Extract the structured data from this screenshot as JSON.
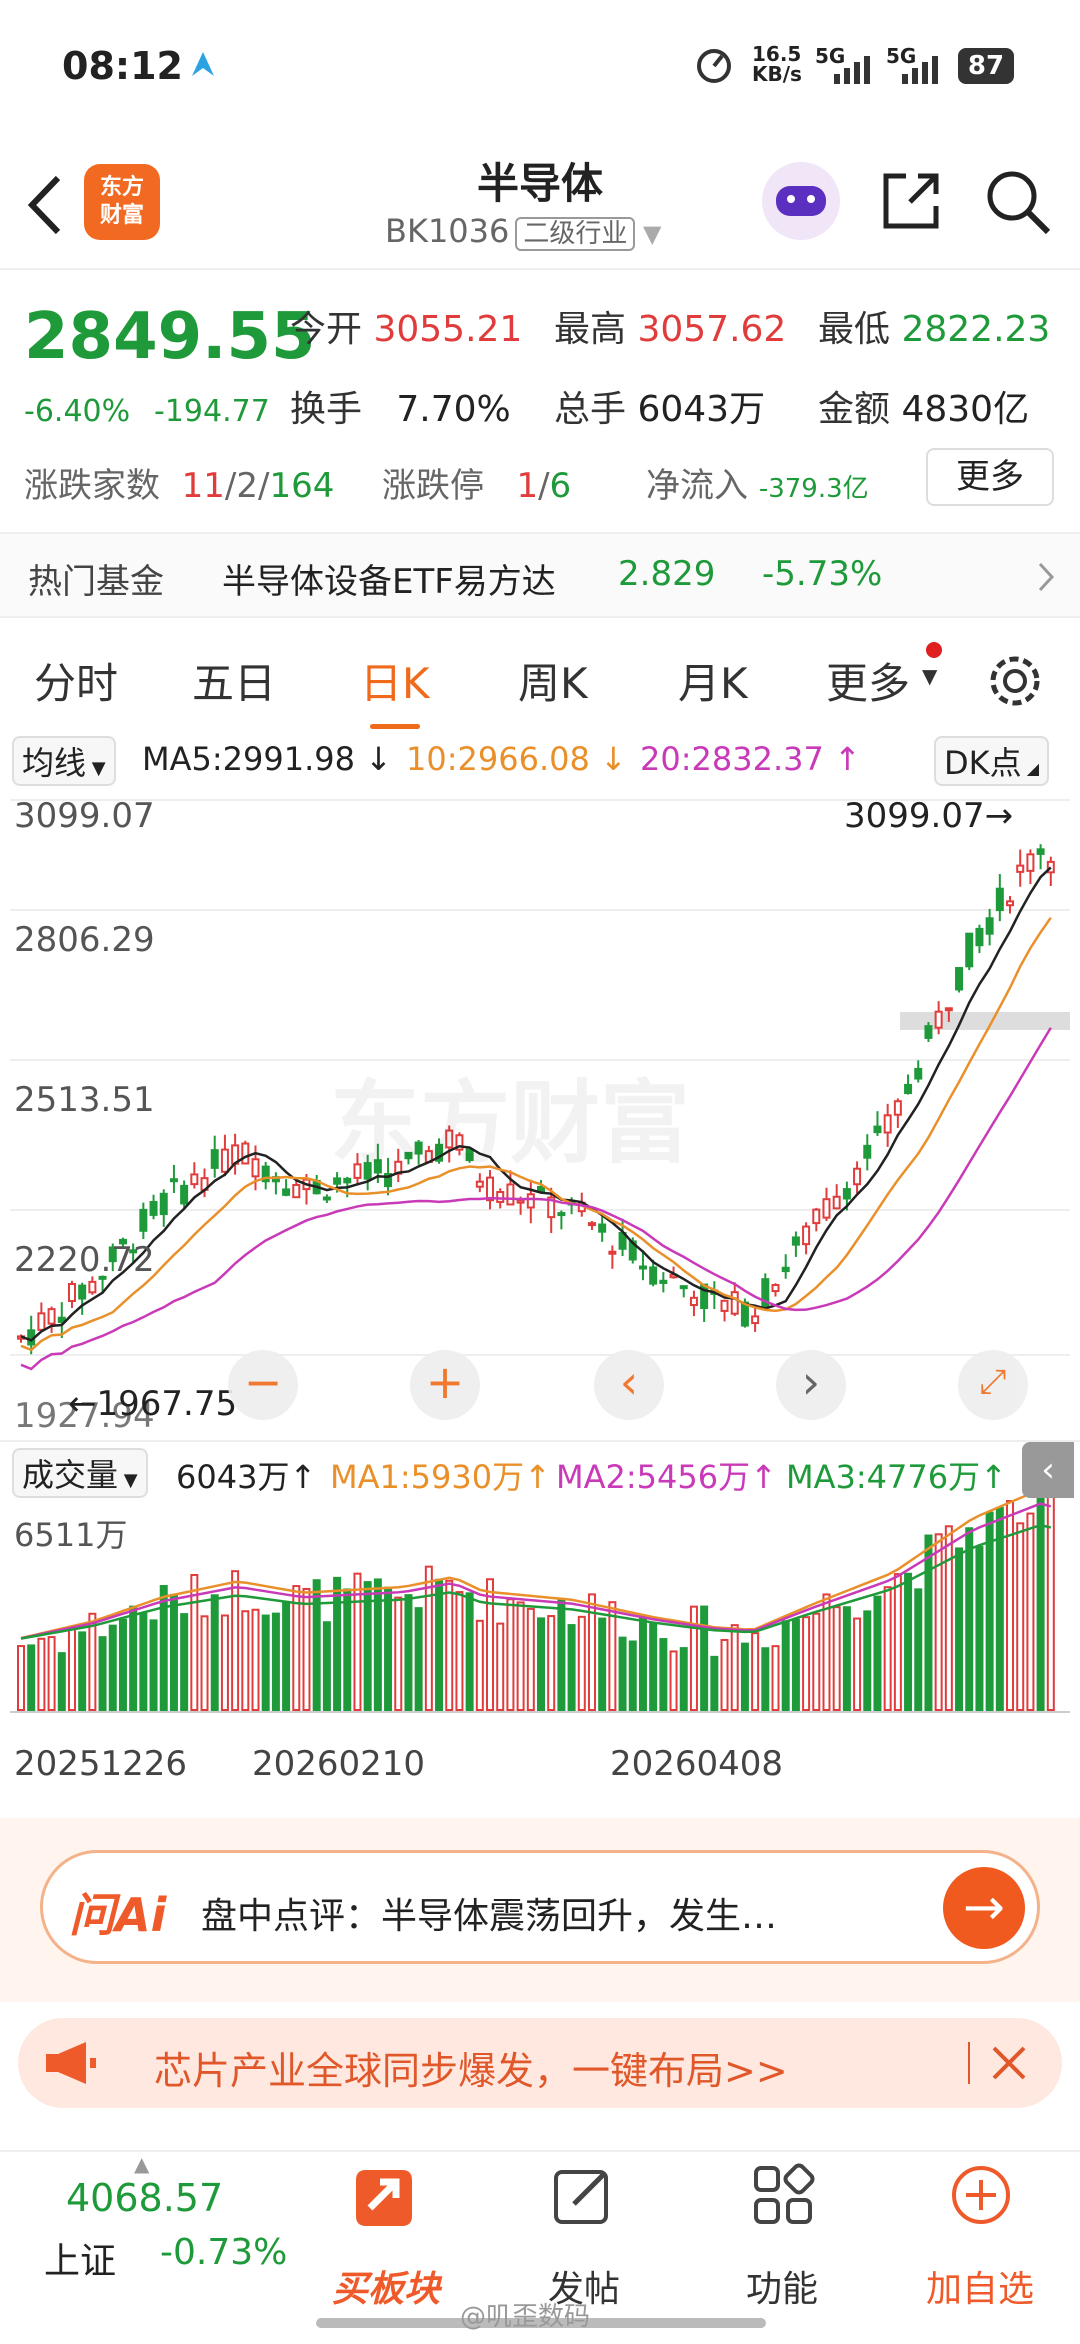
{
  "status": {
    "time": "08:12",
    "speed": "16.5",
    "speed_unit": "KB/s",
    "net1": "5G",
    "net2": "5G",
    "battery": "87"
  },
  "header": {
    "title": "半导体",
    "code": "BK1036",
    "tag": "二级行业",
    "logo_line1": "东方",
    "logo_line2": "财富"
  },
  "quote": {
    "price": "2849.55",
    "change_pct": "-6.40%",
    "change": "-194.77",
    "open_label": "今开",
    "open": "3055.21",
    "high_label": "最高",
    "high": "3057.62",
    "low_label": "最低",
    "low": "2822.23",
    "turnover_label": "换手",
    "turnover": "7.70%",
    "volume_label": "总手",
    "volume": "6043万",
    "amount_label": "金额",
    "amount": "4830亿",
    "updown_label": "涨跌家数",
    "up": "11",
    "flat": "2",
    "down": "164",
    "limit_label": "涨跌停",
    "limit_up": "1",
    "limit_down": "6",
    "inflow_label": "净流入",
    "inflow": "-379.3亿",
    "more": "更多"
  },
  "fund": {
    "label": "热门基金",
    "name": "半导体设备ETF易方达",
    "price": "2.829",
    "pct": "-5.73%"
  },
  "tabs": [
    "分时",
    "五日",
    "日K",
    "周K",
    "月K",
    "更多"
  ],
  "ma_row": {
    "selector": "均线",
    "ma5": "MA5:2991.98",
    "ma10": "10:2966.08",
    "ma20": "20:2832.37",
    "dk": "DK点"
  },
  "vol_row": {
    "selector": "成交量",
    "vol": "6043万",
    "ma1": "MA1:5930万",
    "ma2": "MA2:5456万",
    "ma3": "MA3:4776万"
  },
  "chart_data": {
    "type": "candlestick",
    "y_ticks": [
      "3099.07",
      "2806.29",
      "2513.51",
      "2220.72",
      "1927.94"
    ],
    "ylim": [
      1927.94,
      3099.07
    ],
    "high_label": "3099.07",
    "low_label": "1967.75",
    "vol_max_label": "6511万",
    "x_labels": [
      "20251226",
      "20260210",
      "20260408"
    ],
    "watermark": "东方财富",
    "colors": {
      "up": "#e03c3c",
      "down": "#1f9a3a",
      "ma5": "#222222",
      "ma10": "#e9902a",
      "ma20": "#c93ab8"
    }
  },
  "ai": {
    "logo": "问Ai",
    "text": "盘中点评：半导体震荡回升，发生…"
  },
  "banner": {
    "text": "芯片产业全球同步爆发，一键布局>>"
  },
  "bottom": {
    "index_value": "4068.57",
    "index_name": "上证",
    "index_pct": "-0.73%",
    "b1": "买板块",
    "b2": "发帖",
    "b3": "功能",
    "b4": "加自选"
  },
  "footer": "@叽歪数码"
}
